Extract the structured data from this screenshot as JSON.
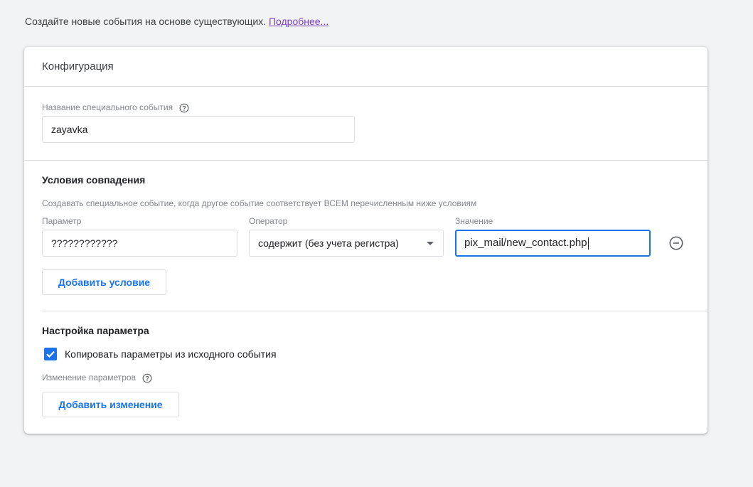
{
  "intro": {
    "text": "Создайте новые события на основе существующих.",
    "link": "Подробнее..."
  },
  "config": {
    "title": "Конфигурация",
    "event_name": {
      "label": "Название специального события",
      "value": "zayavka"
    },
    "conditions": {
      "title": "Условия совпадения",
      "description": "Создавать специальное событие, когда другое событие соответствует ВСЕМ перечисленным ниже условиям",
      "parameter_label": "Параметр",
      "operator_label": "Оператор",
      "value_label": "Значение",
      "rows": [
        {
          "parameter": "????????????",
          "operator": "содержит (без учета регистра)",
          "value": "pix_mail/new_contact.php"
        }
      ],
      "add_button": "Добавить условие"
    },
    "params": {
      "title": "Настройка параметра",
      "copy_checkbox_label": "Копировать параметры из исходного события",
      "copy_checked": true,
      "changes_label": "Изменение параметров",
      "add_button": "Добавить изменение"
    }
  },
  "colors": {
    "accent": "#1a73e8",
    "link": "#7b3fbf",
    "background": "#f1f3f4"
  }
}
